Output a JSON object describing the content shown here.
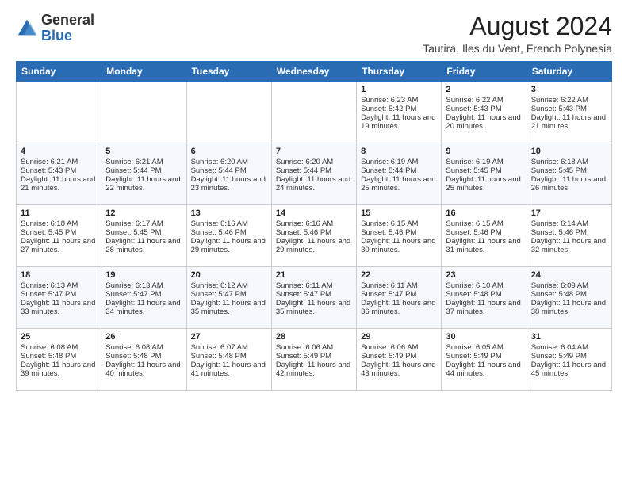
{
  "logo": {
    "general": "General",
    "blue": "Blue"
  },
  "header": {
    "title": "August 2024",
    "subtitle": "Tautira, Iles du Vent, French Polynesia"
  },
  "days_of_week": [
    "Sunday",
    "Monday",
    "Tuesday",
    "Wednesday",
    "Thursday",
    "Friday",
    "Saturday"
  ],
  "weeks": [
    [
      {
        "day": "",
        "sunrise": "",
        "sunset": "",
        "daylight": ""
      },
      {
        "day": "",
        "sunrise": "",
        "sunset": "",
        "daylight": ""
      },
      {
        "day": "",
        "sunrise": "",
        "sunset": "",
        "daylight": ""
      },
      {
        "day": "",
        "sunrise": "",
        "sunset": "",
        "daylight": ""
      },
      {
        "day": "1",
        "sunrise": "Sunrise: 6:23 AM",
        "sunset": "Sunset: 5:42 PM",
        "daylight": "Daylight: 11 hours and 19 minutes."
      },
      {
        "day": "2",
        "sunrise": "Sunrise: 6:22 AM",
        "sunset": "Sunset: 5:43 PM",
        "daylight": "Daylight: 11 hours and 20 minutes."
      },
      {
        "day": "3",
        "sunrise": "Sunrise: 6:22 AM",
        "sunset": "Sunset: 5:43 PM",
        "daylight": "Daylight: 11 hours and 21 minutes."
      }
    ],
    [
      {
        "day": "4",
        "sunrise": "Sunrise: 6:21 AM",
        "sunset": "Sunset: 5:43 PM",
        "daylight": "Daylight: 11 hours and 21 minutes."
      },
      {
        "day": "5",
        "sunrise": "Sunrise: 6:21 AM",
        "sunset": "Sunset: 5:44 PM",
        "daylight": "Daylight: 11 hours and 22 minutes."
      },
      {
        "day": "6",
        "sunrise": "Sunrise: 6:20 AM",
        "sunset": "Sunset: 5:44 PM",
        "daylight": "Daylight: 11 hours and 23 minutes."
      },
      {
        "day": "7",
        "sunrise": "Sunrise: 6:20 AM",
        "sunset": "Sunset: 5:44 PM",
        "daylight": "Daylight: 11 hours and 24 minutes."
      },
      {
        "day": "8",
        "sunrise": "Sunrise: 6:19 AM",
        "sunset": "Sunset: 5:44 PM",
        "daylight": "Daylight: 11 hours and 25 minutes."
      },
      {
        "day": "9",
        "sunrise": "Sunrise: 6:19 AM",
        "sunset": "Sunset: 5:45 PM",
        "daylight": "Daylight: 11 hours and 25 minutes."
      },
      {
        "day": "10",
        "sunrise": "Sunrise: 6:18 AM",
        "sunset": "Sunset: 5:45 PM",
        "daylight": "Daylight: 11 hours and 26 minutes."
      }
    ],
    [
      {
        "day": "11",
        "sunrise": "Sunrise: 6:18 AM",
        "sunset": "Sunset: 5:45 PM",
        "daylight": "Daylight: 11 hours and 27 minutes."
      },
      {
        "day": "12",
        "sunrise": "Sunrise: 6:17 AM",
        "sunset": "Sunset: 5:45 PM",
        "daylight": "Daylight: 11 hours and 28 minutes."
      },
      {
        "day": "13",
        "sunrise": "Sunrise: 6:16 AM",
        "sunset": "Sunset: 5:46 PM",
        "daylight": "Daylight: 11 hours and 29 minutes."
      },
      {
        "day": "14",
        "sunrise": "Sunrise: 6:16 AM",
        "sunset": "Sunset: 5:46 PM",
        "daylight": "Daylight: 11 hours and 29 minutes."
      },
      {
        "day": "15",
        "sunrise": "Sunrise: 6:15 AM",
        "sunset": "Sunset: 5:46 PM",
        "daylight": "Daylight: 11 hours and 30 minutes."
      },
      {
        "day": "16",
        "sunrise": "Sunrise: 6:15 AM",
        "sunset": "Sunset: 5:46 PM",
        "daylight": "Daylight: 11 hours and 31 minutes."
      },
      {
        "day": "17",
        "sunrise": "Sunrise: 6:14 AM",
        "sunset": "Sunset: 5:46 PM",
        "daylight": "Daylight: 11 hours and 32 minutes."
      }
    ],
    [
      {
        "day": "18",
        "sunrise": "Sunrise: 6:13 AM",
        "sunset": "Sunset: 5:47 PM",
        "daylight": "Daylight: 11 hours and 33 minutes."
      },
      {
        "day": "19",
        "sunrise": "Sunrise: 6:13 AM",
        "sunset": "Sunset: 5:47 PM",
        "daylight": "Daylight: 11 hours and 34 minutes."
      },
      {
        "day": "20",
        "sunrise": "Sunrise: 6:12 AM",
        "sunset": "Sunset: 5:47 PM",
        "daylight": "Daylight: 11 hours and 35 minutes."
      },
      {
        "day": "21",
        "sunrise": "Sunrise: 6:11 AM",
        "sunset": "Sunset: 5:47 PM",
        "daylight": "Daylight: 11 hours and 35 minutes."
      },
      {
        "day": "22",
        "sunrise": "Sunrise: 6:11 AM",
        "sunset": "Sunset: 5:47 PM",
        "daylight": "Daylight: 11 hours and 36 minutes."
      },
      {
        "day": "23",
        "sunrise": "Sunrise: 6:10 AM",
        "sunset": "Sunset: 5:48 PM",
        "daylight": "Daylight: 11 hours and 37 minutes."
      },
      {
        "day": "24",
        "sunrise": "Sunrise: 6:09 AM",
        "sunset": "Sunset: 5:48 PM",
        "daylight": "Daylight: 11 hours and 38 minutes."
      }
    ],
    [
      {
        "day": "25",
        "sunrise": "Sunrise: 6:08 AM",
        "sunset": "Sunset: 5:48 PM",
        "daylight": "Daylight: 11 hours and 39 minutes."
      },
      {
        "day": "26",
        "sunrise": "Sunrise: 6:08 AM",
        "sunset": "Sunset: 5:48 PM",
        "daylight": "Daylight: 11 hours and 40 minutes."
      },
      {
        "day": "27",
        "sunrise": "Sunrise: 6:07 AM",
        "sunset": "Sunset: 5:48 PM",
        "daylight": "Daylight: 11 hours and 41 minutes."
      },
      {
        "day": "28",
        "sunrise": "Sunrise: 6:06 AM",
        "sunset": "Sunset: 5:49 PM",
        "daylight": "Daylight: 11 hours and 42 minutes."
      },
      {
        "day": "29",
        "sunrise": "Sunrise: 6:06 AM",
        "sunset": "Sunset: 5:49 PM",
        "daylight": "Daylight: 11 hours and 43 minutes."
      },
      {
        "day": "30",
        "sunrise": "Sunrise: 6:05 AM",
        "sunset": "Sunset: 5:49 PM",
        "daylight": "Daylight: 11 hours and 44 minutes."
      },
      {
        "day": "31",
        "sunrise": "Sunrise: 6:04 AM",
        "sunset": "Sunset: 5:49 PM",
        "daylight": "Daylight: 11 hours and 45 minutes."
      }
    ]
  ]
}
